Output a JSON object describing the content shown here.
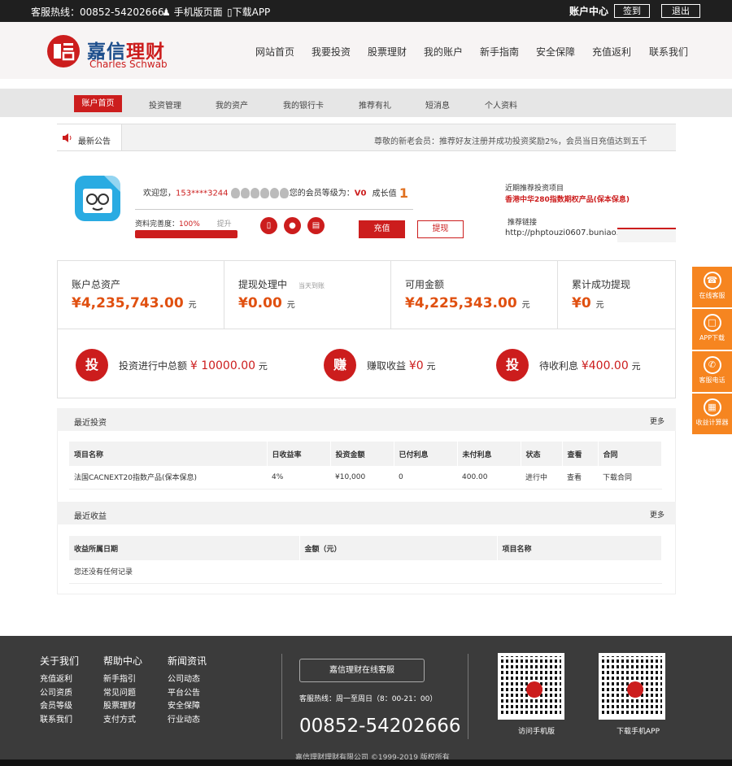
{
  "topbar": {
    "hotline": "客服热线：00852-54202666",
    "mobile": "手机版页面",
    "app": "下载APP",
    "account_center": "账户中心",
    "login": "签到",
    "logout": "退出"
  },
  "logo": {
    "cn_a": "嘉信",
    "cn_b": "理财",
    "en": "Charles Schwab",
    "badge": "口言"
  },
  "nav": [
    "网站首页",
    "我要投资",
    "股票理财",
    "我的账户",
    "新手指南",
    "安全保障",
    "充值返利",
    "联系我们"
  ],
  "subnav": [
    "账户首页",
    "投资管理",
    "我的资产",
    "我的银行卡",
    "推荐有礼",
    "短消息",
    "个人资料"
  ],
  "notice": {
    "label": "最新公告",
    "text": "尊敬的新老会员：推荐好友注册并成功投资奖励2%，会员当日充值达到五千以上"
  },
  "user": {
    "welcome_prefix": "欢迎您，",
    "phone": "153****3244",
    "level_prefix": "您的会员等级为：",
    "level": "V0",
    "growth_label": "成长值",
    "growth": "1",
    "profile_label": "资料完善度：",
    "profile_pct": "100%",
    "upgrade": "提升",
    "charge_btn": "充值",
    "withdraw_btn": "提现",
    "completion": 1.0
  },
  "recommend": {
    "label": "近期推荐投资项目",
    "product": "香港中华280指数期权产品(保本保息)",
    "ref_label": "推荐链接",
    "ref_url": "http://phptouzi0607.buniao..."
  },
  "assets": [
    {
      "title": "账户总资产",
      "note": "",
      "value": "¥4,235,743.00",
      "unit": "元"
    },
    {
      "title": "提现处理中",
      "note": "当天到账",
      "value": "¥0.00",
      "unit": "元"
    },
    {
      "title": "可用金额",
      "note": "",
      "value": "¥4,225,343.00",
      "unit": "元"
    },
    {
      "title": "累计成功提现",
      "note": "",
      "value": "¥0",
      "unit": "元"
    }
  ],
  "stats": [
    {
      "icon": "投",
      "label": "投资进行中总额",
      "value": "¥ 10000.00",
      "unit": "元"
    },
    {
      "icon": "赚",
      "label": "赚取收益",
      "value": "¥0",
      "unit": "元"
    },
    {
      "icon": "投",
      "label": "待收利息",
      "value": "¥400.00",
      "unit": "元"
    }
  ],
  "recent_invest": {
    "title": "最近投资",
    "more": "更多",
    "headers": [
      "项目名称",
      "日收益率",
      "投资金额",
      "已付利息",
      "未付利息",
      "状态",
      "查看",
      "合同"
    ],
    "rows": [
      [
        "法国CACNEXT20指数产品(保本保息)",
        "4%",
        "¥10,000",
        "0",
        "400.00",
        "进行中",
        "查看",
        "下载合同"
      ]
    ]
  },
  "recent_income": {
    "title": "最近收益",
    "more": "更多",
    "headers": [
      "收益所属日期",
      "金额（元）",
      "项目名称"
    ],
    "empty": "您还没有任何记录"
  },
  "sidebar": [
    "在线客服",
    "APP下载",
    "客服电话",
    "收益计算器"
  ],
  "footer": {
    "cols": [
      {
        "title": "关于我们",
        "items": [
          "充值返利",
          "公司资质",
          "会员等级",
          "联系我们"
        ]
      },
      {
        "title": "帮助中心",
        "items": [
          "新手指引",
          "常见问题",
          "股票理财",
          "支付方式"
        ]
      },
      {
        "title": "新闻资讯",
        "items": [
          "公司动态",
          "平台公告",
          "安全保障",
          "行业动态"
        ]
      }
    ],
    "service_btn": "嘉信理财在线客服",
    "service_time": "客服热线：周一至周日（8：00-21：00）",
    "phone": "00852-54202666",
    "qr1": "访问手机版",
    "qr2": "下载手机APP",
    "copyright": "嘉信理财理财有限公司 ©1999-2019 版权所有"
  }
}
